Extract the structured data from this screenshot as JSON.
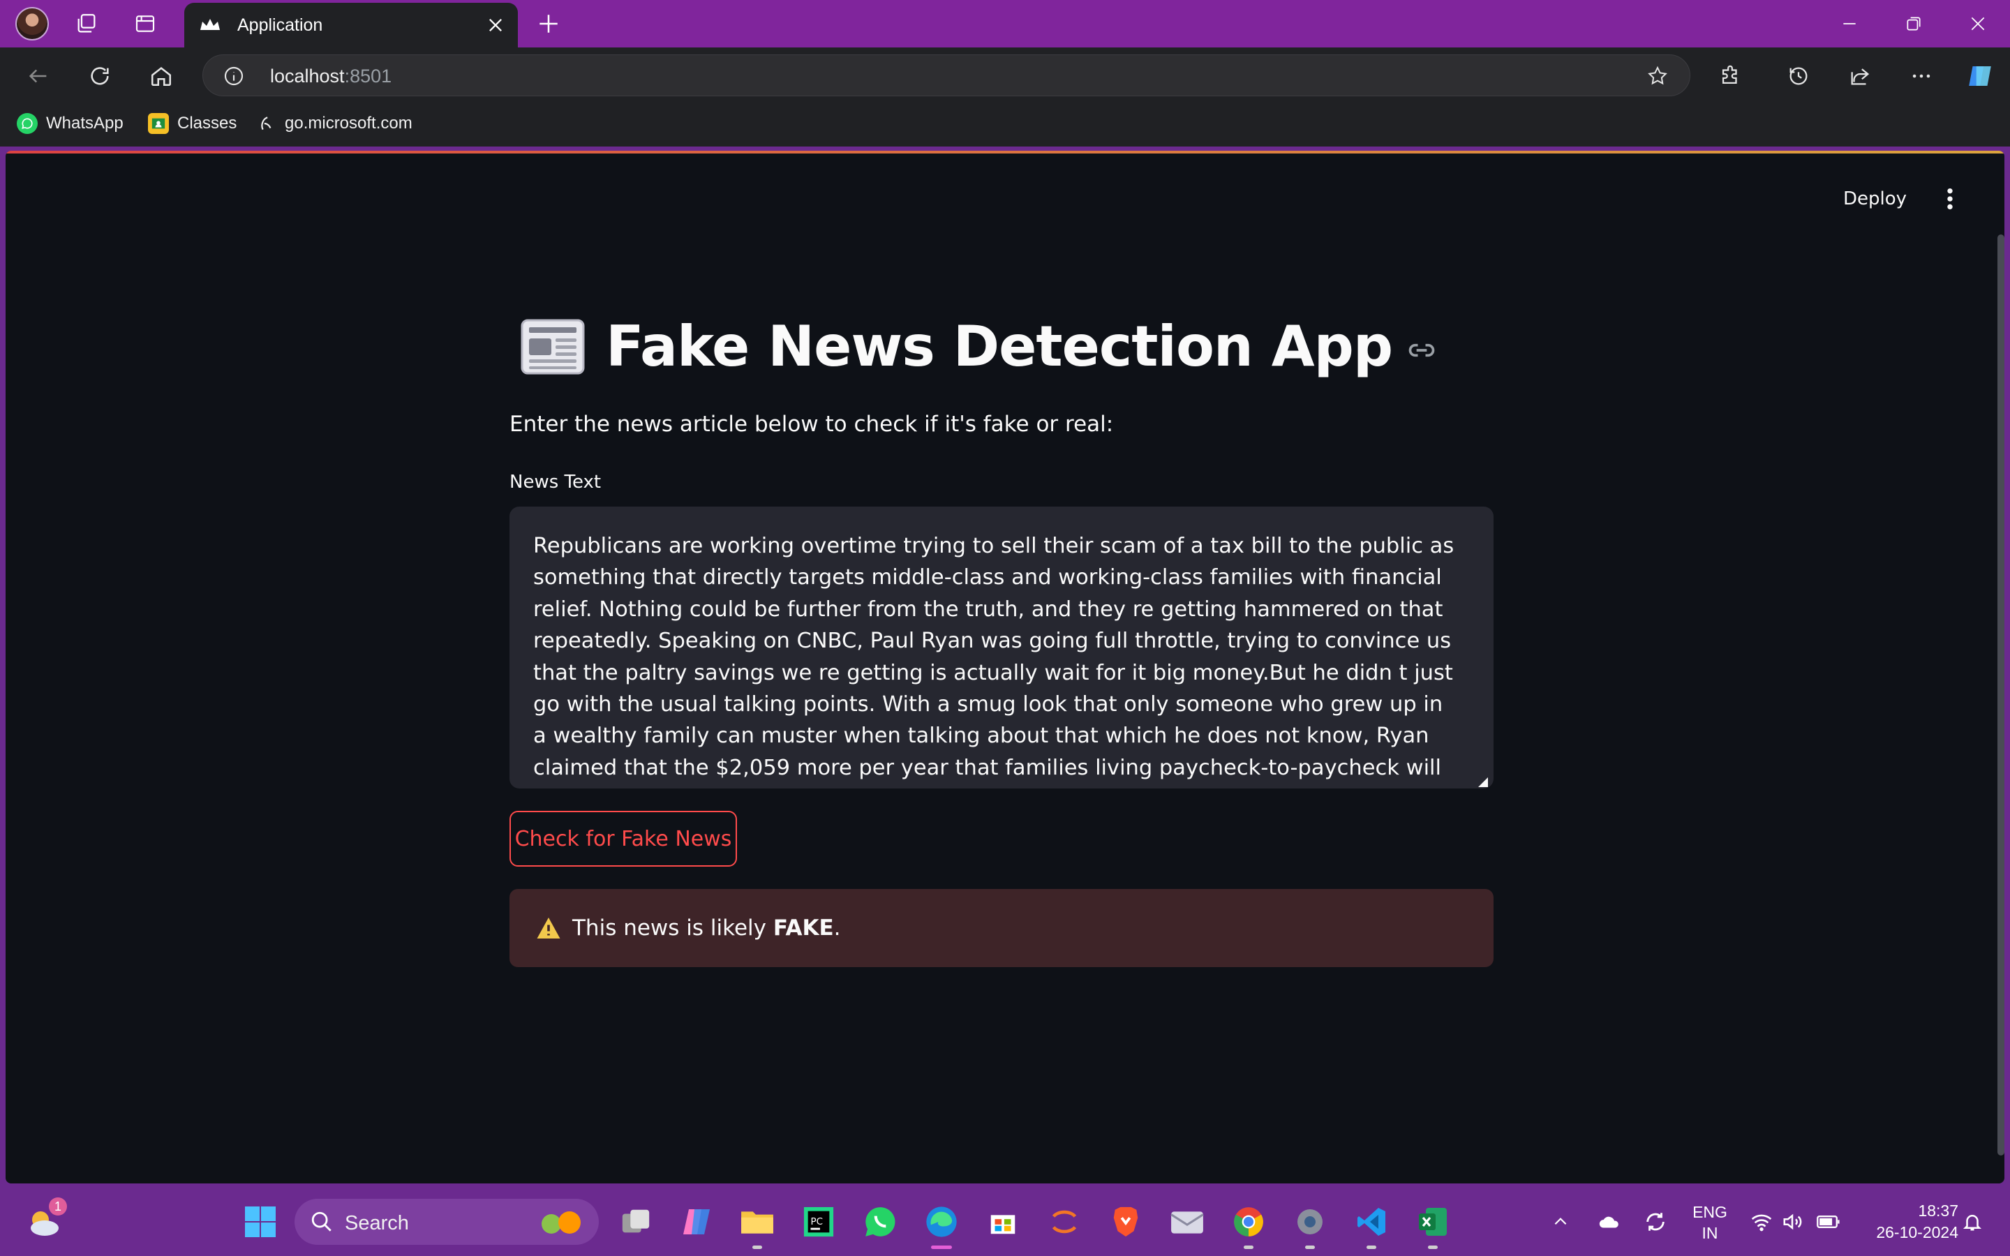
{
  "browser": {
    "tab_title": "Application",
    "url_host": "localhost",
    "url_port": ":8501",
    "bookmarks": [
      {
        "label": "WhatsApp"
      },
      {
        "label": "Classes"
      },
      {
        "label": "go.microsoft.com"
      }
    ]
  },
  "app": {
    "deploy_label": "Deploy",
    "title": "Fake News Detection App",
    "subtitle": "Enter the news article below to check if it's fake or real:",
    "field_label": "News Text",
    "news_text": "Republicans are working overtime trying to sell their scam of a tax bill to the public as something that directly targets middle-class and working-class families with financial relief. Nothing could be further from the truth, and they re getting hammered on that repeatedly. Speaking on CNBC, Paul Ryan was going full throttle, trying to convince us that the paltry savings we re getting is actually wait for it big money.But he didn t just go with the usual talking points. With a smug look that only someone who grew up in a wealthy family can muster when talking about that which he does not know, Ryan claimed that the $2,059 more per year that families living paycheck-to-paycheck will see is extremely significant. Then he decided he had to amend that to say such savings might be",
    "button_label": "Check for Fake News",
    "result_prefix": "This news is likely ",
    "result_verdict": "FAKE",
    "result_suffix": "."
  },
  "taskbar": {
    "weather_badge": "1",
    "search_placeholder": "Search",
    "lang_line1": "ENG",
    "lang_line2": "IN",
    "time": "18:37",
    "date": "26-10-2024"
  },
  "colors": {
    "accent": "#ff4b4b",
    "background": "#0e1117",
    "input_bg": "#262730",
    "warning_bg": "#3e2428",
    "tabbar": "#80259c"
  }
}
